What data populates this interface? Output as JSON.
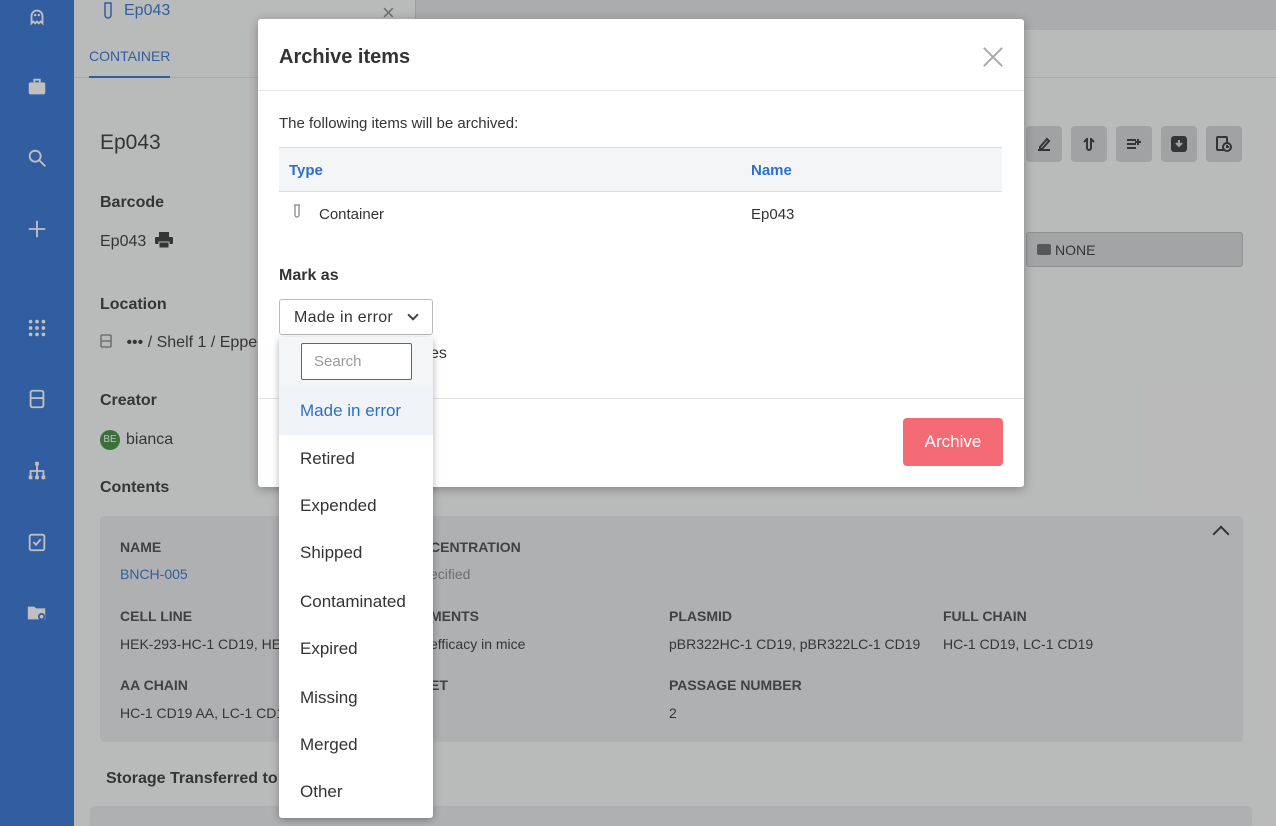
{
  "tab": {
    "title": "Ep043",
    "close": "×"
  },
  "subnav": {
    "item": "CONTAINER"
  },
  "page": {
    "title": "Ep043",
    "barcode_label": "Barcode",
    "barcode_value": "Ep043",
    "location_label": "Location",
    "location_value": "••• / Shelf 1 / Eppe",
    "creator_label": "Creator",
    "creator_initials": "BE",
    "creator_name": "bianca",
    "contents_label": "Contents",
    "none_button": "NONE",
    "storage_title": "Storage Transferred to"
  },
  "contents": {
    "name_label": "NAME",
    "name_value": "BNCH-005",
    "concentration_label": "CENTRATION",
    "concentration_value": "ecified",
    "cell_line_label": "CELL LINE",
    "cell_line_value": "HEK-293-HC-1 CD19, HEK",
    "comments_label": "MENTS",
    "comments_value": "efficacy in mice",
    "plasmid_label": "PLASMID",
    "plasmid_value": "pBR322HC-1 CD19, pBR322LC-1 CD19",
    "full_chain_label": "FULL CHAIN",
    "full_chain_value": "HC-1 CD19, LC-1 CD19",
    "aa_chain_label": "AA CHAIN",
    "aa_chain_value": "HC-1 CD19 AA, LC-1 CD19",
    "target_label": "ET",
    "passage_label": "PASSAGE NUMBER",
    "passage_value": "2"
  },
  "modal": {
    "title": "Archive items",
    "intro": "The following items will be archived:",
    "table": {
      "headers": {
        "type": "Type",
        "name": "Name"
      },
      "rows": [
        {
          "type": "Container",
          "name": "Ep043"
        }
      ]
    },
    "mark_as_label": "Mark as",
    "selected_value": "Made in error",
    "partial_text": "es",
    "archive_button": "Archive"
  },
  "dropdown": {
    "search_placeholder": "Search",
    "options": [
      "Made in error",
      "Retired",
      "Expended",
      "Shipped",
      "Contaminated",
      "Expired",
      "Missing",
      "Merged",
      "Other"
    ]
  },
  "colors": {
    "sidebar": "#2d6fd0",
    "accent": "#2d6fd0",
    "archive": "#f46a75"
  },
  "icons": [
    "ghost-logo-icon",
    "briefcase-icon",
    "search-icon",
    "plus-icon",
    "apps-grid-icon",
    "box-icon",
    "hierarchy-icon",
    "clipboard-check-icon",
    "folder-settings-icon"
  ]
}
